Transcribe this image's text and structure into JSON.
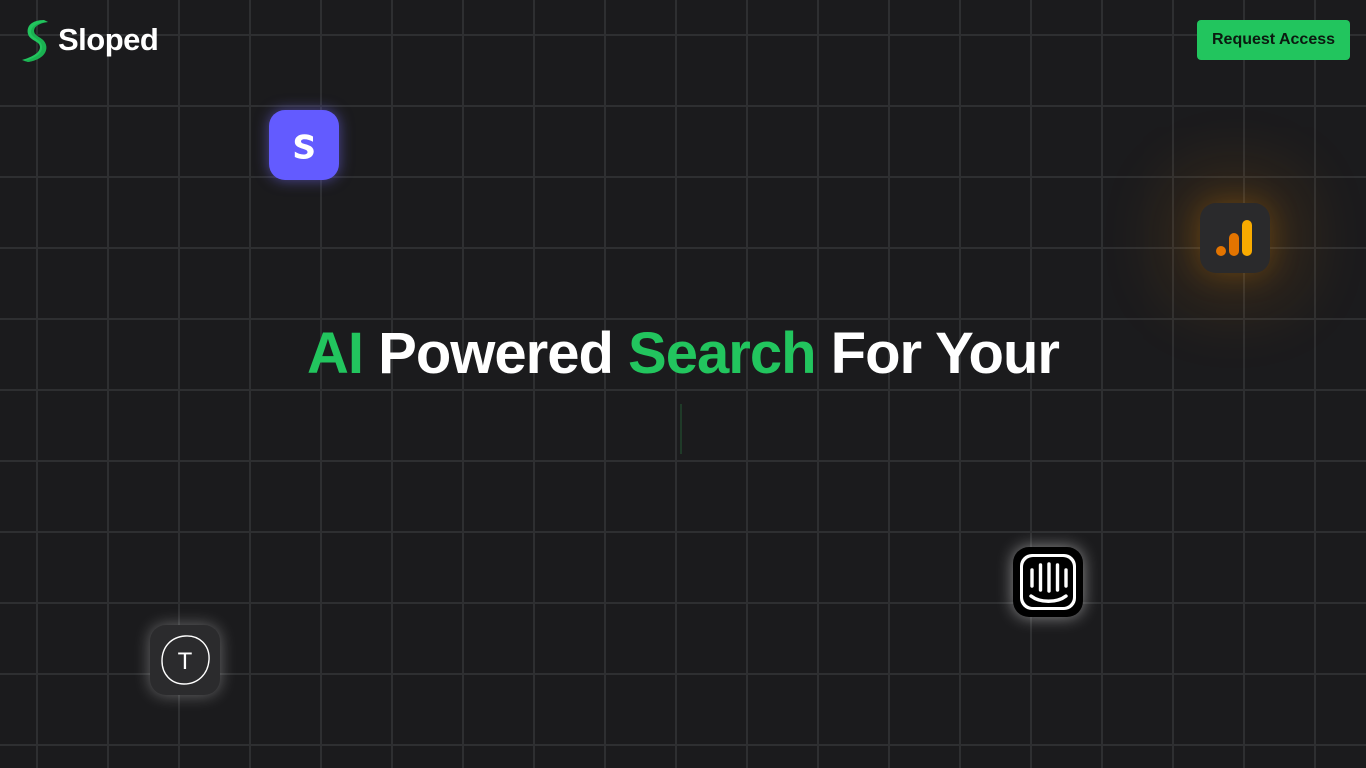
{
  "brand": {
    "name": "Sloped",
    "accent_color": "#22c55e",
    "logo_icon": "sloped-logo-icon"
  },
  "header": {
    "cta_label": "Request Access"
  },
  "hero": {
    "word_1": "AI",
    "word_2": "Powered",
    "word_3": "Search",
    "word_4": "For Your"
  },
  "integrations": [
    {
      "name": "stripe-icon",
      "letter": "S",
      "color": "#635bff"
    },
    {
      "name": "google-analytics-icon",
      "color": "#f9ab00"
    },
    {
      "name": "intercom-icon",
      "color": "#000000"
    },
    {
      "name": "typeform-icon",
      "letter": "T",
      "color": "#2b2b2d"
    }
  ],
  "colors": {
    "background": "#1b1b1d",
    "grid_line": "#2e2f31",
    "hero_white": "#ffffff"
  }
}
